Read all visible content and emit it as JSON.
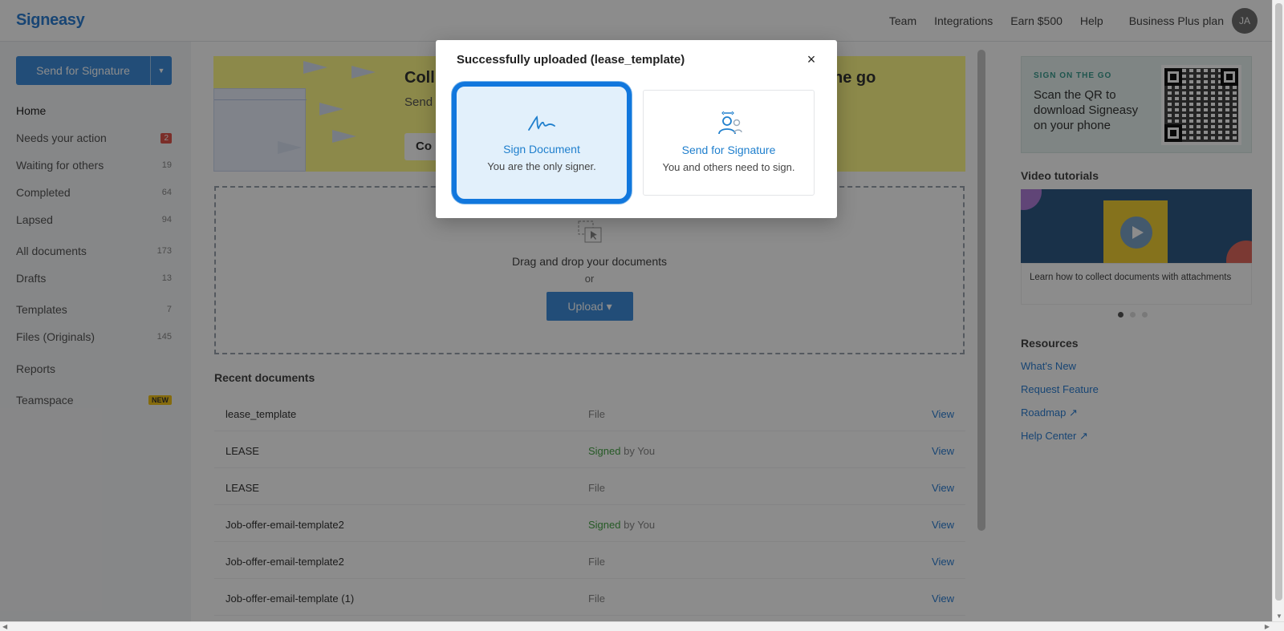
{
  "app": {
    "logo": "Signeasy",
    "nav": [
      "Team",
      "Integrations",
      "Earn $500",
      "Help"
    ],
    "plan": "Business Plus plan",
    "avatar_initials": "JA"
  },
  "sidebar": {
    "send_button": "Send for Signature",
    "items": [
      {
        "label": "Home",
        "count": ""
      },
      {
        "label": "Needs your action",
        "count": "2"
      },
      {
        "label": "Waiting for others",
        "count": "19"
      },
      {
        "label": "Completed",
        "count": "64"
      },
      {
        "label": "Lapsed",
        "count": "94"
      },
      {
        "label": "All documents",
        "count": "173"
      },
      {
        "label": "Drafts",
        "count": "13"
      },
      {
        "label": "Templates",
        "count": "7"
      },
      {
        "label": "Files (Originals)",
        "count": "145"
      },
      {
        "label": "Reports",
        "count": ""
      },
      {
        "label": "Teamspace",
        "count": "NEW"
      }
    ]
  },
  "banner": {
    "title_left": "Coll",
    "title_right": "he go",
    "sub": "Send contr",
    "cta": "Co"
  },
  "dropzone": {
    "text": "Drag and drop your documents",
    "or": "or",
    "upload": "Upload ▾"
  },
  "recent": {
    "title": "Recent documents",
    "rows": [
      {
        "name": "lease_template",
        "status": "File",
        "signed": "",
        "view": "View"
      },
      {
        "name": "LEASE",
        "status": " by You",
        "signed": "Signed",
        "view": "View"
      },
      {
        "name": "LEASE",
        "status": "File",
        "signed": "",
        "view": "View"
      },
      {
        "name": "Job-offer-email-template2",
        "status": " by You",
        "signed": "Signed",
        "view": "View"
      },
      {
        "name": "Job-offer-email-template2",
        "status": "File",
        "signed": "",
        "view": "View"
      },
      {
        "name": "Job-offer-email-template (1)",
        "status": "File",
        "signed": "",
        "view": "View"
      }
    ]
  },
  "right": {
    "qr_eyebrow": "SIGN ON THE GO",
    "qr_msg": "Scan the QR to download Signeasy on your phone",
    "video_title": "Video tutorials",
    "video_caption": "Learn how to collect documents with attachments",
    "resources_title": "Resources",
    "resources": [
      "What's New",
      "Request Feature",
      "Roadmap ↗",
      "Help Center ↗"
    ]
  },
  "modal": {
    "title": "Successfully uploaded (lease_template)",
    "close": "×",
    "options": [
      {
        "title": "Sign Document",
        "desc": "You are the only signer.",
        "icon": "signature-icon",
        "selected": true
      },
      {
        "title": "Send for Signature",
        "desc": "You and others need to sign.",
        "icon": "multi-signer-icon",
        "selected": false
      }
    ]
  },
  "colors": {
    "brand": "#2d7fd3",
    "button": "#3e8ddb",
    "banner": "#fffa87",
    "selection_ring": "#1177dd",
    "signed": "#46a546"
  }
}
